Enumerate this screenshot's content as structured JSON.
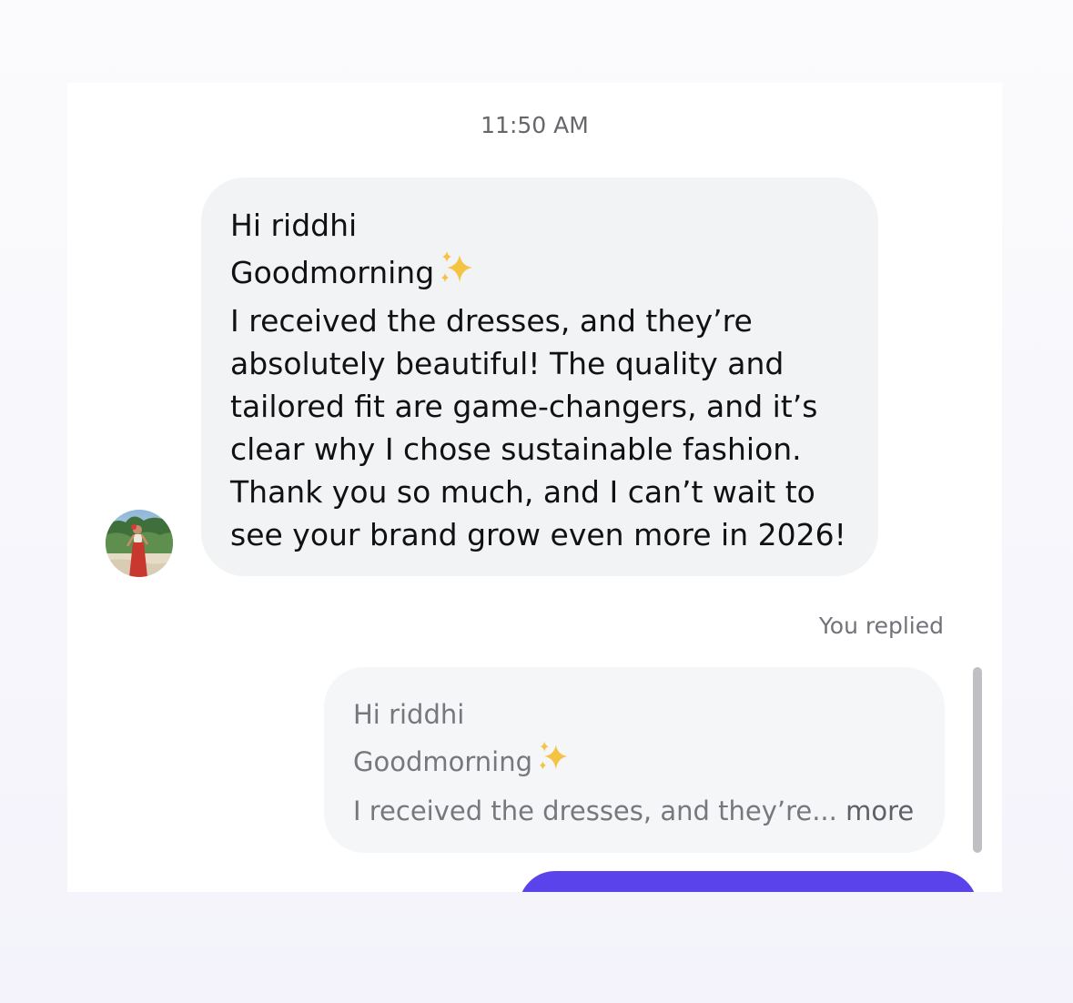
{
  "conversation": {
    "timestamp": "11:50 AM",
    "incoming_message": {
      "line1": "Hi riddhi",
      "line2": "Goodmorning",
      "line2_emoji": "sparkles-icon",
      "body": "I received the dresses, and they’re\nabsolutely beautiful! The quality and\ntailored fit are game-changers, and it’s\nclear why I chose sustainable fashion.\nThank you so much, and I can’t wait to\nsee your brand grow even more in 2026!"
    },
    "reply_label": "You replied",
    "quoted_reply": {
      "line1": "Hi riddhi",
      "line2": "Goodmorning",
      "line3": "I received the dresses, and they’re...",
      "more": "more"
    }
  },
  "colors": {
    "incoming_bubble": "#f2f3f5",
    "quoted_bubble": "#f5f6f8",
    "outgoing_bubble": "#5b43ec",
    "sparkle": "#f5c343"
  }
}
